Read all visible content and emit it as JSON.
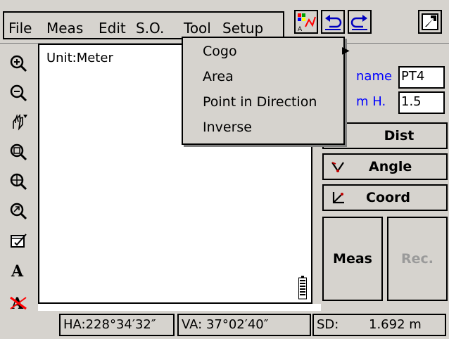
{
  "menubar": {
    "items": [
      "File",
      "Meas",
      "Edit",
      "S.O.",
      "Tool",
      "Setup"
    ]
  },
  "toolbar_right": {
    "icons": [
      "map-color-icon",
      "undo-icon",
      "redo-icon",
      "exit-icon"
    ]
  },
  "left_toolbar": {
    "icons": [
      "zoom-in-icon",
      "zoom-out-icon",
      "pan-icon",
      "zoom-window-icon",
      "zoom-extent-icon",
      "zoom-previous-icon",
      "properties-icon",
      "text-icon",
      "text-off-icon"
    ]
  },
  "canvas": {
    "unit_label": "Unit:Meter"
  },
  "right_panel": {
    "name_label": "name",
    "name_value": "PT4",
    "height_label": "m H.",
    "height_value": "1.5",
    "dist_label": "Dist",
    "angle_label": "Angle",
    "coord_label": "Coord",
    "meas_label": "Meas",
    "rec_label": "Rec."
  },
  "status": {
    "ha": "HA:228°34′32″",
    "va": "VA: 37°02′40″",
    "sd_label": "SD:",
    "sd_value": "1.692  m"
  },
  "dropdown": {
    "items": [
      "Cogo",
      "Area",
      "Point in Direction",
      "Inverse"
    ]
  },
  "colors": {
    "chrome": "#d6d3ce",
    "link_blue": "#0000ff",
    "accent_red": "#c00000"
  }
}
